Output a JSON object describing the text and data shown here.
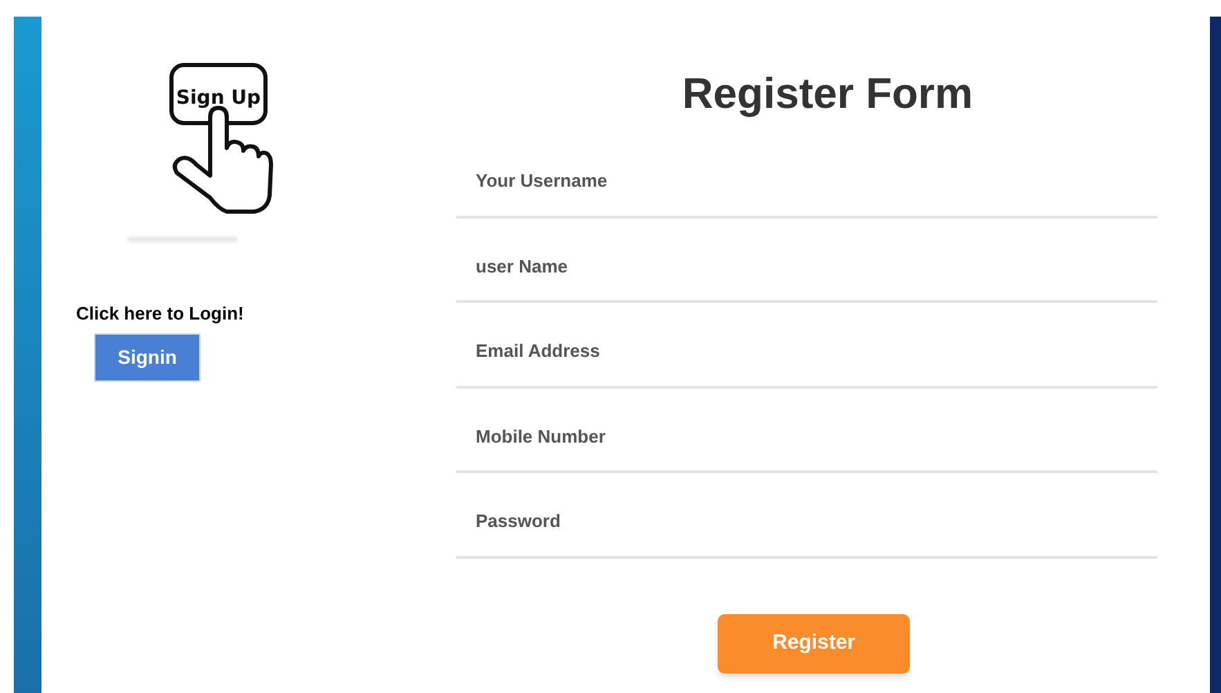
{
  "illustration": {
    "label": "Sign Up"
  },
  "login": {
    "prompt": "Click here to Login!",
    "button": "Signin"
  },
  "form": {
    "title": "Register Form",
    "fields": [
      {
        "placeholder": "Your Username"
      },
      {
        "placeholder": "user Name"
      },
      {
        "placeholder": "Email Address"
      },
      {
        "placeholder": "Mobile Number"
      },
      {
        "placeholder": "Password"
      }
    ],
    "submit": "Register"
  }
}
